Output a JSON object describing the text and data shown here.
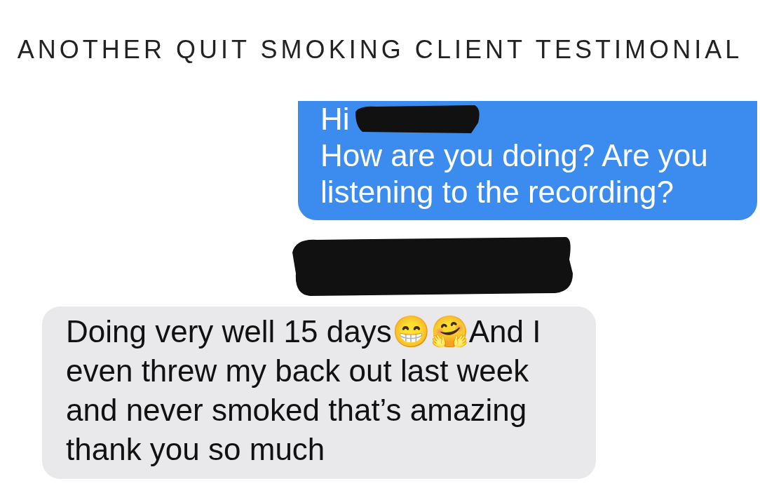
{
  "page": {
    "title": "ANOTHER QUIT SMOKING CLIENT TESTIMONIAL"
  },
  "messages": [
    {
      "kind": "sent",
      "greeting": "Hi",
      "redacted": true,
      "text": "How are you doing? Are you listening to the recording?"
    },
    {
      "kind": "received",
      "redacted": true,
      "text": "Doing very well 15 days😁🤗And I even threw my back out last week and never smoked that’s amazing thank you so much"
    }
  ]
}
